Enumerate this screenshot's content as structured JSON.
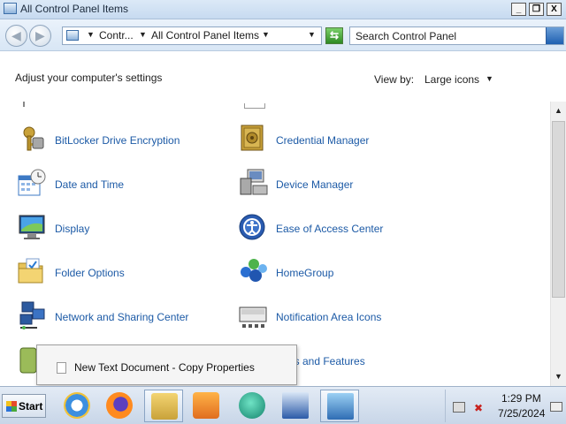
{
  "window": {
    "title": "All Control Panel Items",
    "minimize_label": "_",
    "maximize_label": "❐",
    "close_label": "X"
  },
  "navigation": {
    "back_glyph": "◀",
    "forward_glyph": "▶",
    "breadcrumbs": [
      "Contr...",
      "All Control Panel Items"
    ],
    "search_placeholder": "Search Control Panel",
    "refresh_glyph": "⇆"
  },
  "header": {
    "title": "Adjust your computer's settings",
    "view_by_label": "View by:",
    "view_by_value": "Large icons"
  },
  "items": {
    "left": [
      {
        "label": "BitLocker Drive Encryption",
        "icon": "bitlocker-keys-icon"
      },
      {
        "label": "Date and Time",
        "icon": "calendar-clock-icon"
      },
      {
        "label": "Display",
        "icon": "monitor-icon"
      },
      {
        "label": "Folder Options",
        "icon": "folder-icon"
      },
      {
        "label": "Network and Sharing Center",
        "icon": "network-icon"
      }
    ],
    "right": [
      {
        "label": "Credential Manager",
        "icon": "vault-icon"
      },
      {
        "label": "Device Manager",
        "icon": "device-manager-icon"
      },
      {
        "label": "Ease of Access Center",
        "icon": "ease-of-access-icon"
      },
      {
        "label": "HomeGroup",
        "icon": "homegroup-icon"
      },
      {
        "label": "Notification Area Icons",
        "icon": "notification-area-icon"
      },
      {
        "label": "Programs and Features",
        "visible_text": "rams and Features",
        "icon": "programs-icon"
      }
    ]
  },
  "popup": {
    "label": "New Text Document - Copy Properties"
  },
  "taskbar": {
    "start_label": "Start",
    "apps": [
      "internet-explorer-icon",
      "firefox-icon",
      "control-panel-icon",
      "media-player-icon",
      "browser-icon",
      "task-manager-icon",
      "control-panel-active-icon"
    ],
    "time": "1:29 PM",
    "date": "7/25/2024"
  },
  "colors": {
    "link": "#1c5aa6",
    "titlebar": "#c7daf0"
  }
}
